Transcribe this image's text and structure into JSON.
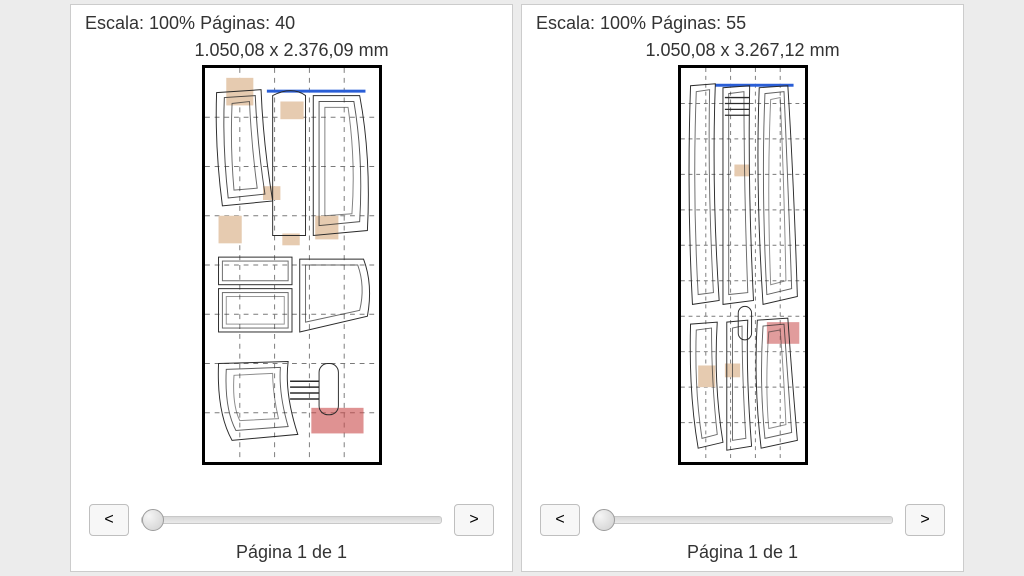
{
  "left": {
    "header": "Escala: 100% Páginas: 40",
    "dimensions": "1.050,08 x 2.376,09 mm",
    "page_caption": "Página 1 de 1",
    "prev_label": "<",
    "next_label": ">",
    "slider_min": 1,
    "slider_max": 1,
    "slider_value": 1,
    "canvas_width_mm": 1050.08,
    "canvas_height_mm": 2376.09
  },
  "right": {
    "header": "Escala: 100% Páginas: 55",
    "dimensions": "1.050,08 x 3.267,12 mm",
    "page_caption": "Página 1 de 1",
    "prev_label": "<",
    "next_label": ">",
    "slider_min": 1,
    "slider_max": 1,
    "slider_value": 1,
    "canvas_width_mm": 1050.08,
    "canvas_height_mm": 3267.12
  }
}
